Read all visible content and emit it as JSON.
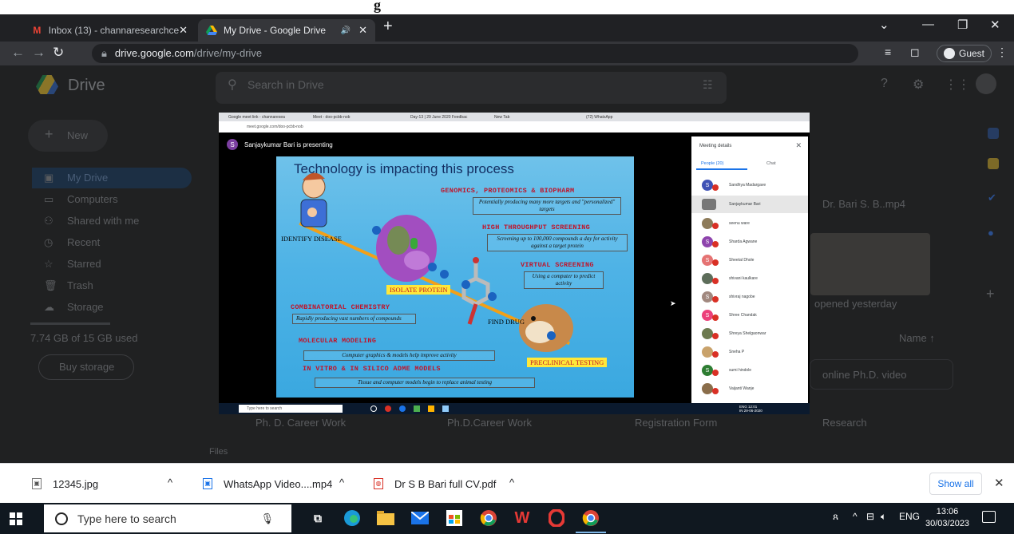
{
  "page_fragment": "g",
  "browser": {
    "tabs": [
      {
        "title": "Inbox (13) - channaresearchcente",
        "icon": "gmail-icon"
      },
      {
        "title": "My Drive - Google Drive",
        "icon": "drive-icon",
        "audio": "🔊"
      }
    ],
    "url_domain": "drive.google.com",
    "url_path": "/drive/my-drive",
    "profile": "Guest"
  },
  "drive": {
    "title": "Drive",
    "search_placeholder": "Search in Drive",
    "new_label": "New",
    "nav": [
      "My Drive",
      "Computers",
      "Shared with me",
      "Recent",
      "Starred",
      "Trash",
      "Storage"
    ],
    "storage_text": "7.74 GB of 15 GB used",
    "buy_storage": "Buy storage",
    "file_preview_name": "Dr. Bari S. B..mp4",
    "opened_text": "opened yesterday",
    "name_header": "Name ↑",
    "files_label": "Files",
    "quick_items": [
      "Ph. D. Career Work",
      "Ph.D.Career Work",
      "Registration Form",
      "Research"
    ],
    "online_item": "online Ph.D. video"
  },
  "meet": {
    "inner_tabs": [
      "Google meet link - channaresea",
      "Meet - doo-pcbb-nob",
      "Day-13 | 29 June 2020 Feedbac",
      "New Tab",
      "(72) WhatsApp"
    ],
    "inner_url": "meet.google.com/doo-pcbb-nob",
    "presenter": "Sanjaykumar Bari is presenting",
    "presenter_initial": "S",
    "panel_title": "Meeting details",
    "people_tab": "People (20)",
    "chat_tab": "Chat",
    "participants": [
      {
        "name": "Sandhya Madargave",
        "initial": "S",
        "color": "#3f51b5"
      },
      {
        "name": "Sanjaykumar Bari",
        "initial": "",
        "color": "#777777"
      },
      {
        "name": "seenu ware",
        "initial": "",
        "color": "#8d7b5a"
      },
      {
        "name": "Sharda Agwane",
        "initial": "S",
        "color": "#8e44ad"
      },
      {
        "name": "Sheetal Dhole",
        "initial": "S",
        "color": "#e57373"
      },
      {
        "name": "shivani kaulkare",
        "initial": "",
        "color": "#5d6d5a"
      },
      {
        "name": "shivraj nagobe",
        "initial": "S",
        "color": "#a1887f"
      },
      {
        "name": "Shree Chandak",
        "initial": "S",
        "color": "#ec407a"
      },
      {
        "name": "Shreya Shelgaonwar",
        "initial": "",
        "color": "#6d7a4f"
      },
      {
        "name": "Sneha P",
        "initial": "",
        "color": "#c9a26b"
      },
      {
        "name": "sumi hindole",
        "initial": "S",
        "color": "#2e7d32"
      },
      {
        "name": "Vaijanti Wanje",
        "initial": "",
        "color": "#8a6d4a"
      }
    ],
    "inner_search": "Type here to search",
    "inner_clock": "ENG 12:01\nIN 29-06-2020"
  },
  "slide": {
    "title": "Technology is impacting this process",
    "genomics": "GENOMICS, PROTEOMICS & BIOPHARM",
    "genomics_box": "Potentially producing many more targets and \"personalized\" targets",
    "hts": "HIGH THROUGHPUT SCREENING",
    "hts_box": "Screening up to 100,000 compounds a day for activity against a target protein",
    "virtual": "VIRTUAL SCREENING",
    "virtual_box": "Using a computer to predict activity",
    "identify": "IDENTIFY DISEASE",
    "isolate": "ISOLATE PROTEIN",
    "combi": "COMBINATORIAL CHEMISTRY",
    "combi_box": "Rapidly producing vast numbers of compounds",
    "find": "FIND DRUG",
    "mm": "MOLECULAR MODELING",
    "mm_box": "Computer graphics & models help improve activity",
    "adme": "IN VITRO & IN SILICO ADME MODELS",
    "adme_box": "Tissue and computer models begin to replace animal testing",
    "preclinical": "PRECLINICAL TESTING"
  },
  "downloads": [
    {
      "name": "12345.jpg"
    },
    {
      "name": "WhatsApp Video....mp4"
    },
    {
      "name": "Dr S B Bari full CV.pdf"
    }
  ],
  "show_all": "Show all",
  "taskbar": {
    "search": "Type here to search",
    "tray_user": "ጸ",
    "lang": "ENG",
    "time": "13:06",
    "date": "30/03/2023"
  }
}
